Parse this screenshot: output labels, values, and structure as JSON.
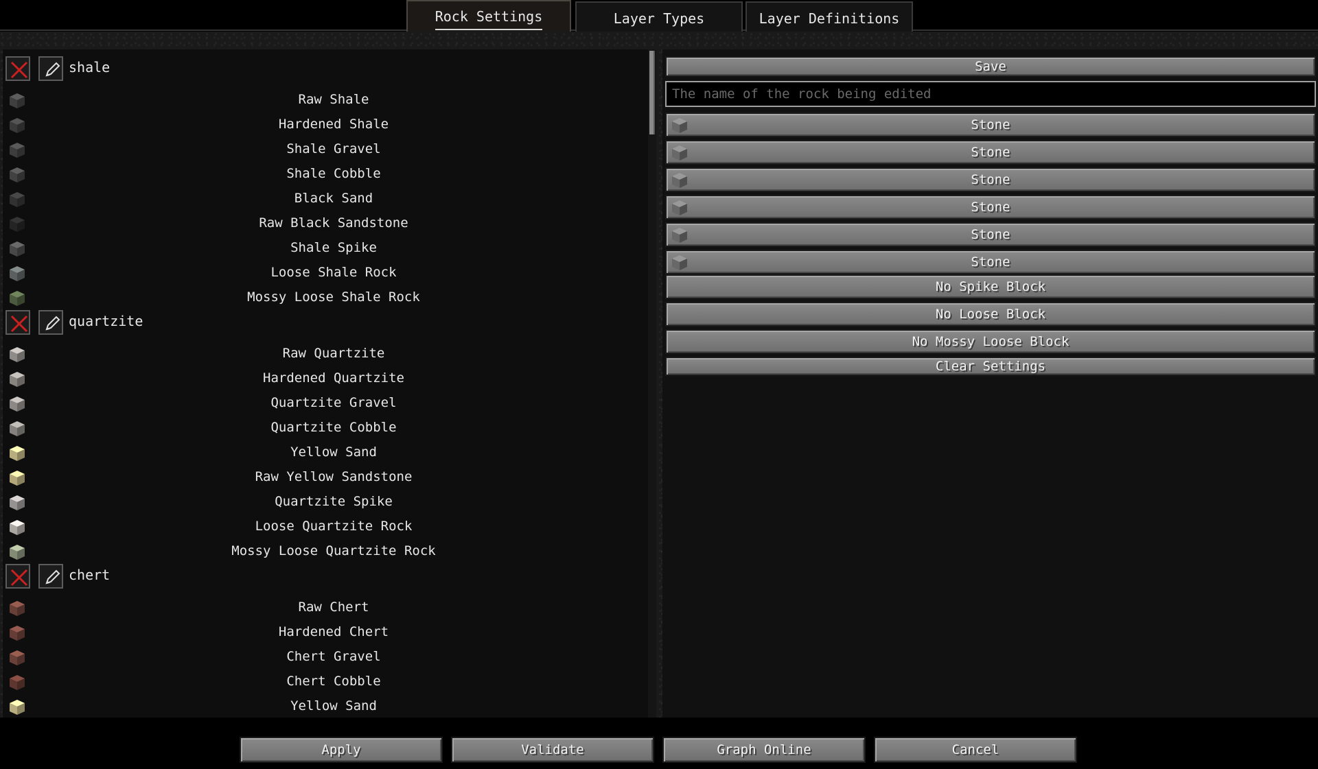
{
  "tabs": [
    {
      "label": "Rock Settings",
      "active": true
    },
    {
      "label": "Layer Types",
      "active": false
    },
    {
      "label": "Layer Definitions",
      "active": false
    }
  ],
  "rocks": [
    {
      "name": "shale",
      "blocks": [
        {
          "label": "Raw Shale",
          "icon": "shale-raw-icon",
          "color": "#4a4a4a"
        },
        {
          "label": "Hardened Shale",
          "icon": "shale-hardened-icon",
          "color": "#444444"
        },
        {
          "label": "Shale Gravel",
          "icon": "shale-gravel-icon",
          "color": "#484848"
        },
        {
          "label": "Shale Cobble",
          "icon": "shale-cobble-icon",
          "color": "#4c4c4c"
        },
        {
          "label": "Black Sand",
          "icon": "black-sand-icon",
          "color": "#3a3a3a"
        },
        {
          "label": "Raw Black Sandstone",
          "icon": "black-sandstone-icon",
          "color": "#2a2a2a"
        },
        {
          "label": "Shale Spike",
          "icon": "shale-spike-icon",
          "color": "#555555"
        },
        {
          "label": "Loose Shale Rock",
          "icon": "loose-shale-rock-icon",
          "color": "#6a7070"
        },
        {
          "label": "Mossy Loose Shale Rock",
          "icon": "mossy-loose-shale-rock-icon",
          "color": "#5a6a4a"
        }
      ]
    },
    {
      "name": "quartzite",
      "blocks": [
        {
          "label": "Raw Quartzite",
          "icon": "quartzite-raw-icon",
          "color": "#a8a4a0"
        },
        {
          "label": "Hardened Quartzite",
          "icon": "quartzite-hardened-icon",
          "color": "#a09c98"
        },
        {
          "label": "Quartzite Gravel",
          "icon": "quartzite-gravel-icon",
          "color": "#a4a09c"
        },
        {
          "label": "Quartzite Cobble",
          "icon": "quartzite-cobble-icon",
          "color": "#9c9894"
        },
        {
          "label": "Yellow Sand",
          "icon": "yellow-sand-icon",
          "color": "#d8cc94"
        },
        {
          "label": "Raw Yellow Sandstone",
          "icon": "yellow-sandstone-icon",
          "color": "#d4c690"
        },
        {
          "label": "Quartzite Spike",
          "icon": "quartzite-spike-icon",
          "color": "#b0acaa"
        },
        {
          "label": "Loose Quartzite Rock",
          "icon": "loose-quartzite-rock-icon",
          "color": "#c8c4c0"
        },
        {
          "label": "Mossy Loose Quartzite Rock",
          "icon": "mossy-loose-quartzite-rock-icon",
          "color": "#9aa48a"
        }
      ]
    },
    {
      "name": "chert",
      "blocks": [
        {
          "label": "Raw Chert",
          "icon": "chert-raw-icon",
          "color": "#7a4a40"
        },
        {
          "label": "Hardened Chert",
          "icon": "chert-hardened-icon",
          "color": "#784840"
        },
        {
          "label": "Chert Gravel",
          "icon": "chert-gravel-icon",
          "color": "#7c4c42"
        },
        {
          "label": "Chert Cobble",
          "icon": "chert-cobble-icon",
          "color": "#6e4038"
        },
        {
          "label": "Yellow Sand",
          "icon": "yellow-sand-icon",
          "color": "#d8cc94"
        }
      ]
    }
  ],
  "editor": {
    "save_label": "Save",
    "name_placeholder": "The name of the rock being edited",
    "block_slots": [
      "Stone",
      "Stone",
      "Stone",
      "Stone",
      "Stone",
      "Stone"
    ],
    "spike_label": "No Spike Block",
    "loose_label": "No Loose Block",
    "mossy_loose_label": "No Mossy Loose Block",
    "clear_label": "Clear Settings"
  },
  "footer": {
    "apply": "Apply",
    "validate": "Validate",
    "graph_online": "Graph Online",
    "cancel": "Cancel"
  },
  "colors": {
    "delete_x": "#cc2020",
    "stone": "#7a7a7a"
  }
}
